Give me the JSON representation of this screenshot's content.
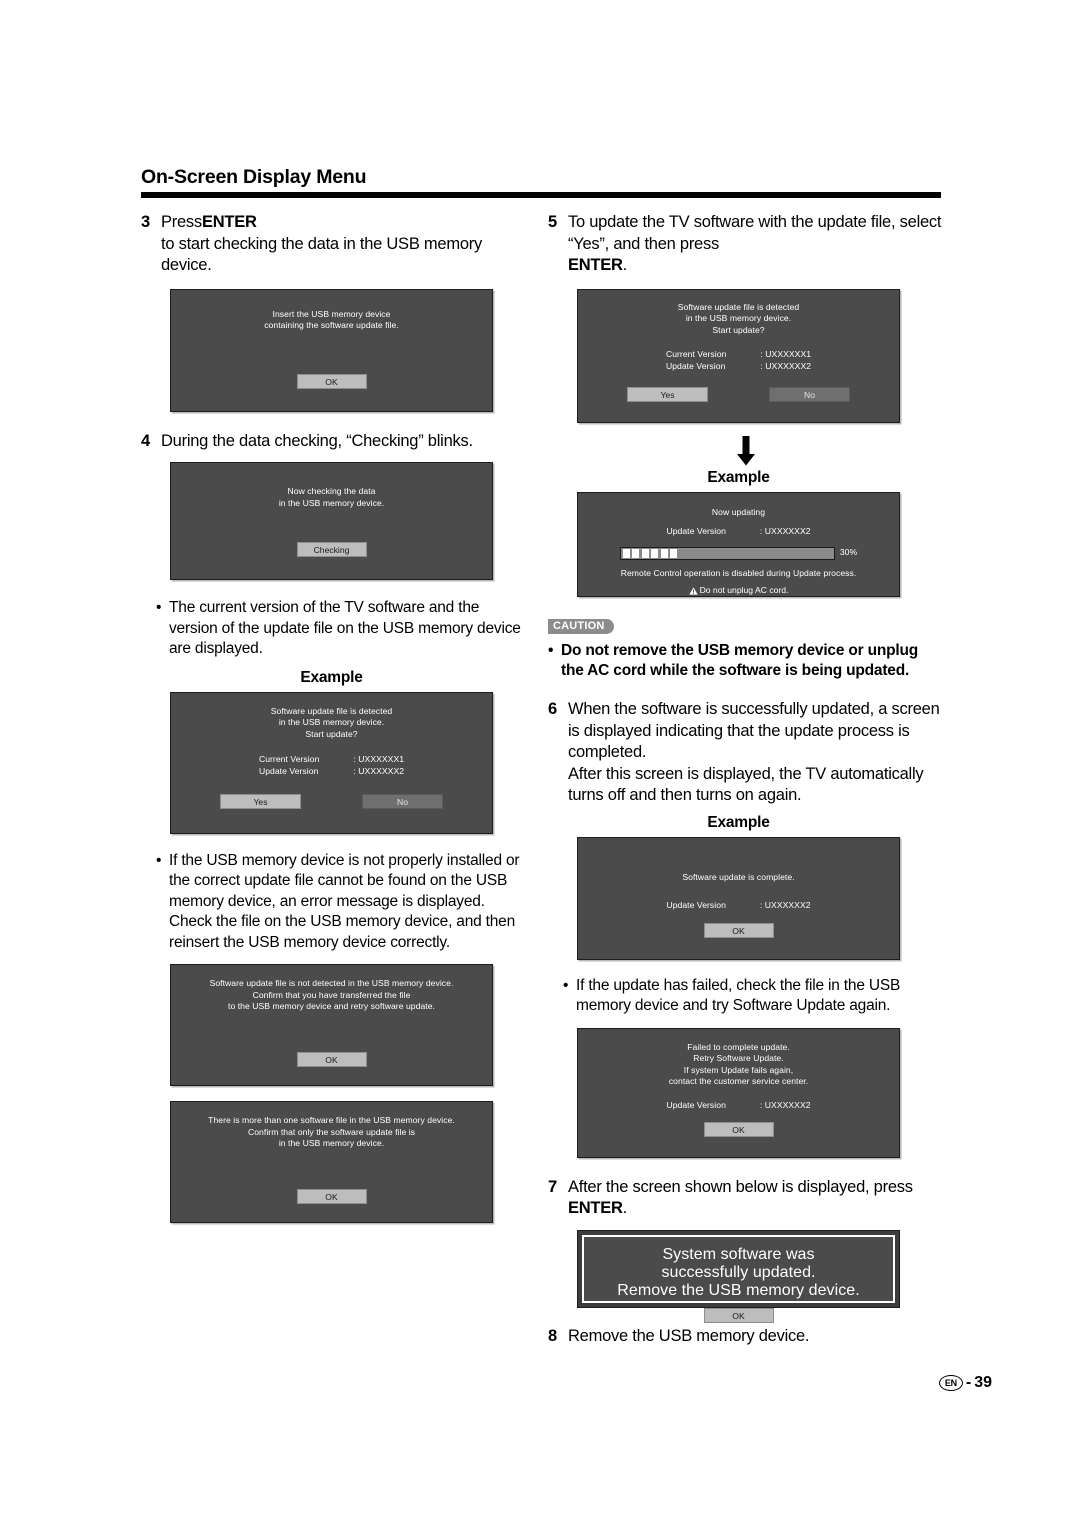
{
  "header": {
    "title": "On-Screen Display Menu"
  },
  "labels": {
    "example": "Example",
    "caution": "CAUTION",
    "bullet_dot": "•"
  },
  "left_column": {
    "step3": {
      "number": "3",
      "text_before_bold": "Press ",
      "bold": "ENTER",
      "text_after_bold": " to start checking the data in the USB memory device."
    },
    "dialog_insert": {
      "lines": [
        "Insert the USB memory device",
        "containing the software update file."
      ],
      "button": "OK"
    },
    "step4": {
      "number": "4",
      "text": "During the data checking, “Checking” blinks."
    },
    "dialog_checking": {
      "lines": [
        "Now checking the data",
        "in the USB memory device."
      ],
      "button": "Checking"
    },
    "bullet_versions": "The current version of the TV software and the version of the update file on the USB memory device are displayed.",
    "dialog_detected": {
      "lines": [
        "Software update file is detected",
        "in the USB memory device.",
        "Start update?"
      ],
      "rows": [
        {
          "label": "Current Version",
          "value": ": UXXXXXX1"
        },
        {
          "label": "Update Version",
          "value": ": UXXXXXX2"
        }
      ],
      "button_yes": "Yes",
      "button_no": "No"
    },
    "bullet_error": "If the USB memory device is not properly installed or the correct update file cannot be found on the USB memory device, an error message is displayed. Check the file on the USB memory device, and then reinsert the USB memory device correctly.",
    "dialog_notdetected": {
      "lines": [
        "Software update file is not detected in the USB memory device.",
        "Confirm that you have transferred the file",
        "to the USB memory device and retry software update."
      ],
      "button": "OK"
    },
    "dialog_morethanone": {
      "lines": [
        "There is more than one software file in the USB memory device.",
        "Confirm that only the software update file is",
        "in the USB memory device."
      ],
      "button": "OK"
    }
  },
  "right_column": {
    "step5": {
      "number": "5",
      "text_before_bold": "To update the TV software with the update file, select “Yes”, and then press ",
      "bold": "ENTER",
      "text_after_bold": "."
    },
    "dialog_detected": {
      "lines": [
        "Software update file is detected",
        "in the USB memory device.",
        "Start update?"
      ],
      "rows": [
        {
          "label": "Current Version",
          "value": ": UXXXXXX1"
        },
        {
          "label": "Update Version",
          "value": ": UXXXXXX2"
        }
      ],
      "button_yes": "Yes",
      "button_no": "No"
    },
    "dialog_updating": {
      "title": "Now updating",
      "rows": [
        {
          "label": "Update Version",
          "value": ": UXXXXXX2"
        }
      ],
      "progress_percent": "30%",
      "progress_value": 30,
      "progress_segments": 6,
      "note": "Remote Control operation is disabled during Update process.",
      "warning": "Do not unplug AC cord."
    },
    "caution_bullet": "Do not remove the USB memory device or unplug the AC cord while the software is being updated.",
    "step6": {
      "number": "6",
      "text": "When the software is successfully updated, a screen is displayed indicating that the update process is completed.",
      "text2": "After this screen is displayed, the TV automatically turns off and then turns on again."
    },
    "dialog_complete": {
      "lines": [
        "Software update is complete."
      ],
      "rows": [
        {
          "label": "Update Version",
          "value": ": UXXXXXX2"
        }
      ],
      "button": "OK"
    },
    "bullet_failed": "If the update has failed, check the file in the USB memory device and try Software Update again.",
    "dialog_failed": {
      "lines": [
        "Failed to complete update.",
        "Retry Software Update.",
        "If system Update fails again,",
        "contact the customer service center."
      ],
      "rows": [
        {
          "label": "Update Version",
          "value": ": UXXXXXX2"
        }
      ],
      "button": "OK"
    },
    "step7": {
      "number": "7",
      "text_before_bold": "After the screen shown below is displayed, press ",
      "bold": "ENTER",
      "text_after_bold": "."
    },
    "dialog_success": {
      "lines": [
        "System software was",
        "successfully updated.",
        "Remove the USB memory device."
      ],
      "button": "OK"
    },
    "step8": {
      "number": "8",
      "text": "Remove the USB memory device."
    }
  },
  "footer": {
    "lang": "EN",
    "separator": "-",
    "page_number": "39"
  }
}
